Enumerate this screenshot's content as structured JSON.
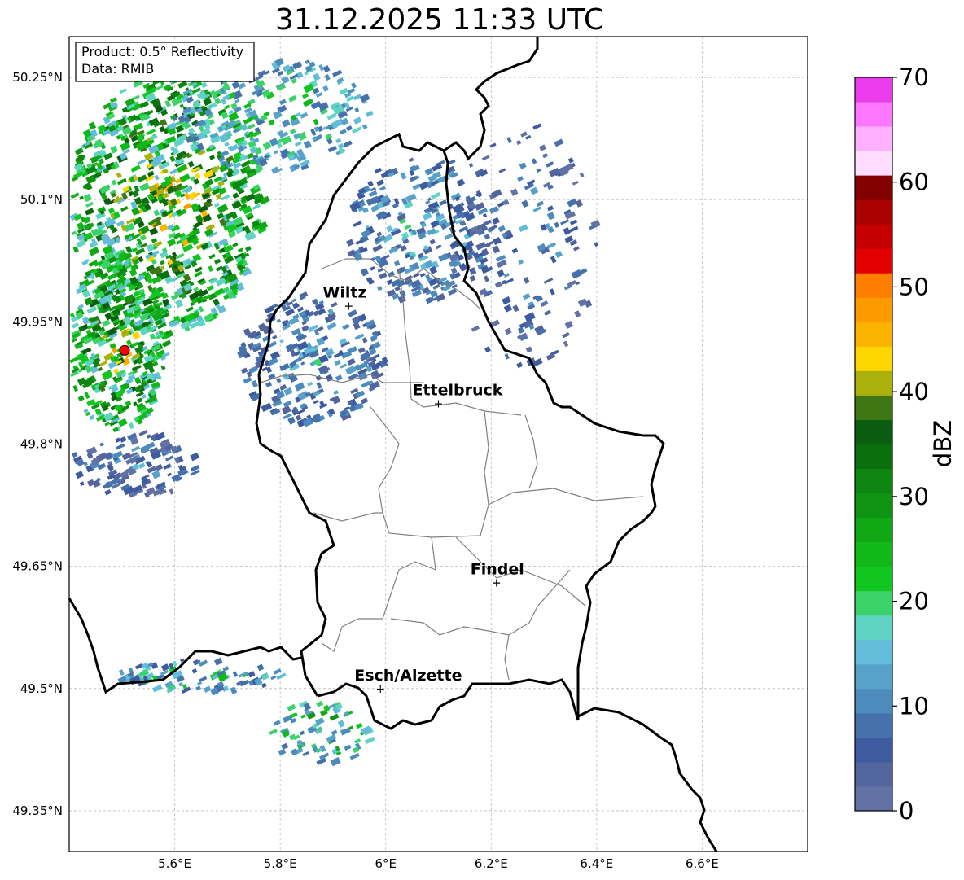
{
  "title": "31.12.2025 11:33 UTC",
  "info_box": {
    "line1": "Product: 0.5° Reflectivity",
    "line2": "Data: RMIB"
  },
  "lat_ticks": [
    {
      "value": 50.25,
      "label": "50.25°N"
    },
    {
      "value": 50.1,
      "label": "50.1°N"
    },
    {
      "value": 49.95,
      "label": "49.95°N"
    },
    {
      "value": 49.8,
      "label": "49.8°N"
    },
    {
      "value": 49.65,
      "label": "49.65°N"
    },
    {
      "value": 49.5,
      "label": "49.5°N"
    },
    {
      "value": 49.35,
      "label": "49.35°N"
    }
  ],
  "lon_ticks": [
    {
      "value": 5.6,
      "label": "5.6°E"
    },
    {
      "value": 5.8,
      "label": "5.8°E"
    },
    {
      "value": 6.0,
      "label": "6°E"
    },
    {
      "value": 6.2,
      "label": "6.2°E"
    },
    {
      "value": 6.4,
      "label": "6.4°E"
    },
    {
      "value": 6.6,
      "label": "6.6°E"
    }
  ],
  "extent": {
    "lon_min": 5.4,
    "lon_max": 6.8,
    "lat_min": 49.3,
    "lat_max": 50.3
  },
  "cities": [
    {
      "name": "Wiltz",
      "lon": 5.93,
      "lat": 49.97
    },
    {
      "name": "Ettelbruck",
      "lon": 6.1,
      "lat": 49.85
    },
    {
      "name": "Findel",
      "lon": 6.21,
      "lat": 49.63
    },
    {
      "name": "Esch/Alzette",
      "lon": 5.99,
      "lat": 49.5
    }
  ],
  "radar_site": {
    "lon": 5.505,
    "lat": 49.915,
    "color": "#ff0000"
  },
  "colorbar": {
    "label": "dBZ",
    "min": 0,
    "max": 70,
    "ticks": [
      "0",
      "10",
      "20",
      "30",
      "40",
      "50",
      "60",
      "70"
    ],
    "colors": [
      "#6272a4",
      "#53659d",
      "#3f5ba0",
      "#4671ab",
      "#4c8bbb",
      "#58a1c9",
      "#62bcda",
      "#5fd4c4",
      "#3cd26a",
      "#12c620",
      "#10b818",
      "#10a815",
      "#0e9411",
      "#0c8610",
      "#0a700e",
      "#0b5c10",
      "#3f7714",
      "#a9b10a",
      "#fdd500",
      "#fcb300",
      "#fc9b00",
      "#fe7e00",
      "#e30000",
      "#c40000",
      "#a90000",
      "#820000",
      "#ffddff",
      "#ffb0ff",
      "#ff76ff",
      "#eb3ceb"
    ]
  }
}
